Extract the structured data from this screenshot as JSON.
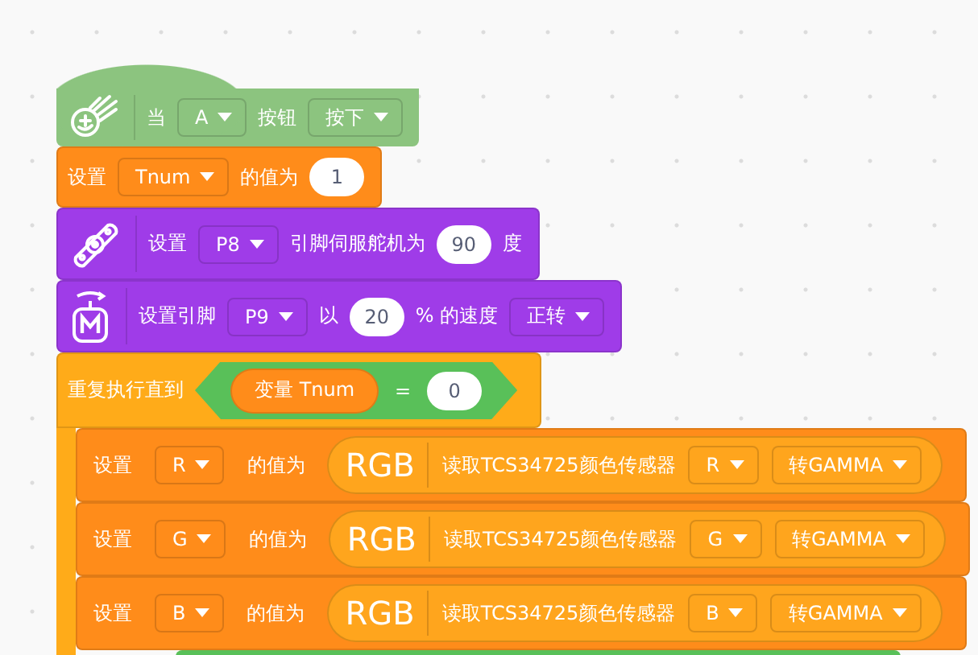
{
  "blocks": [
    {
      "kind": "hat",
      "color": "#8cc47f",
      "parts": [
        {
          "kind": "label",
          "text": "当"
        },
        {
          "kind": "dropdown",
          "text": "A"
        },
        {
          "kind": "label",
          "text": "按钮"
        },
        {
          "kind": "dropdown",
          "text": "按下"
        }
      ]
    },
    {
      "kind": "statement",
      "color": "#ff8c1a",
      "parts": [
        {
          "kind": "label",
          "text": "设置"
        },
        {
          "kind": "dropdown",
          "text": "Tnum"
        },
        {
          "kind": "label",
          "text": "的值为"
        },
        {
          "kind": "number",
          "text": "1"
        }
      ]
    },
    {
      "kind": "servo",
      "color": "#9f3ce8",
      "parts": [
        {
          "kind": "label",
          "text": "设置"
        },
        {
          "kind": "dropdown",
          "text": "P8"
        },
        {
          "kind": "label",
          "text": "引脚伺服舵机为"
        },
        {
          "kind": "number",
          "text": "90"
        },
        {
          "kind": "label",
          "text": "度"
        }
      ]
    },
    {
      "kind": "motor",
      "color": "#9f3ce8",
      "parts": [
        {
          "kind": "label",
          "text": "设置引脚"
        },
        {
          "kind": "dropdown",
          "text": "P9"
        },
        {
          "kind": "label",
          "text": "以"
        },
        {
          "kind": "number",
          "text": "20"
        },
        {
          "kind": "label",
          "text": "% 的速度"
        },
        {
          "kind": "dropdown",
          "text": "正转"
        }
      ]
    },
    {
      "kind": "repeat",
      "color": "#ffab19",
      "parts": [
        {
          "kind": "label",
          "text": "重复执行直到"
        },
        {
          "kind": "condition",
          "parts": [
            {
              "kind": "variable",
              "text": "变量 Tnum"
            },
            {
              "kind": "label",
              "text": "="
            },
            {
              "kind": "number",
              "text": "0"
            }
          ]
        }
      ],
      "children": [
        {
          "kind": "statement",
          "color": "#ff8c1a",
          "parts": [
            {
              "kind": "label",
              "text": "设置"
            },
            {
              "kind": "dropdown",
              "text": "R"
            },
            {
              "kind": "label",
              "text": "的值为"
            },
            {
              "kind": "reporter",
              "badge": "RGB",
              "parts": [
                {
                  "kind": "label",
                  "text": "读取TCS34725颜色传感器"
                },
                {
                  "kind": "dropdown",
                  "text": "R"
                },
                {
                  "kind": "dropdown",
                  "text": "转GAMMA"
                }
              ]
            }
          ]
        },
        {
          "kind": "statement",
          "color": "#ff8c1a",
          "parts": [
            {
              "kind": "label",
              "text": "设置"
            },
            {
              "kind": "dropdown",
              "text": "G"
            },
            {
              "kind": "label",
              "text": "的值为"
            },
            {
              "kind": "reporter",
              "badge": "RGB",
              "parts": [
                {
                  "kind": "label",
                  "text": "读取TCS34725颜色传感器"
                },
                {
                  "kind": "dropdown",
                  "text": "G"
                },
                {
                  "kind": "dropdown",
                  "text": "转GAMMA"
                }
              ]
            }
          ]
        },
        {
          "kind": "statement",
          "color": "#ff8c1a",
          "parts": [
            {
              "kind": "label",
              "text": "设置"
            },
            {
              "kind": "dropdown",
              "text": "B"
            },
            {
              "kind": "label",
              "text": "的值为"
            },
            {
              "kind": "reporter",
              "badge": "RGB",
              "parts": [
                {
                  "kind": "label",
                  "text": "读取TCS34725颜色传感器"
                },
                {
                  "kind": "dropdown",
                  "text": "B"
                },
                {
                  "kind": "dropdown",
                  "text": "转GAMMA"
                }
              ]
            }
          ]
        },
        {
          "kind": "edge",
          "color": "#59c059"
        }
      ]
    }
  ]
}
